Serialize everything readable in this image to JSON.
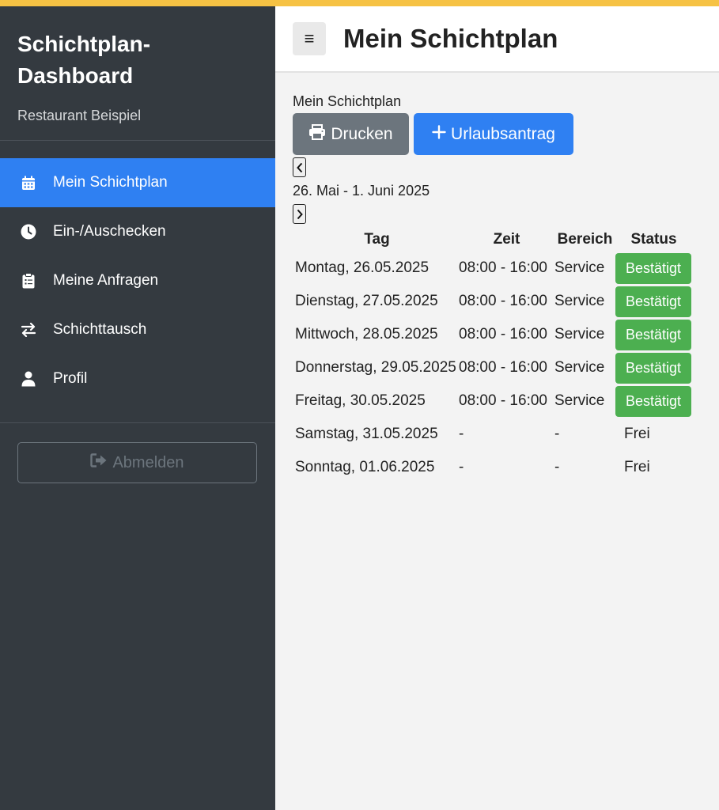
{
  "sidebar": {
    "title_line1": "Schichtplan-",
    "title_line2": "Dashboard",
    "subtitle": "Restaurant Beispiel",
    "items": [
      {
        "label": "Mein Schichtplan",
        "icon": "calendar-icon",
        "active": true
      },
      {
        "label": "Ein-/Auschecken",
        "icon": "clock-icon",
        "active": false
      },
      {
        "label": "Meine Anfragen",
        "icon": "clipboard-icon",
        "active": false
      },
      {
        "label": "Schichttausch",
        "icon": "swap-arrows-icon",
        "active": false
      },
      {
        "label": "Profil",
        "icon": "user-icon",
        "active": false
      }
    ],
    "logout_label": "Abmelden"
  },
  "header": {
    "menu_glyph": "≡",
    "title": "Mein Schichtplan"
  },
  "main": {
    "breadcrumb": "Mein Schichtplan",
    "print_label": "Drucken",
    "vacation_label": "Urlaubsantrag",
    "prev_glyph": "‹",
    "next_glyph": "›",
    "date_range": "26. Mai - 1. Juni 2025",
    "table": {
      "headers": [
        "Tag",
        "Zeit",
        "Bereich",
        "Status"
      ],
      "rows": [
        {
          "day": "Montag, 26.05.2025",
          "time": "08:00 - 16:00",
          "area": "Service",
          "status": "Bestätigt"
        },
        {
          "day": "Dienstag, 27.05.2025",
          "time": "08:00 - 16:00",
          "area": "Service",
          "status": "Bestätigt"
        },
        {
          "day": "Mittwoch, 28.05.2025",
          "time": "08:00 - 16:00",
          "area": "Service",
          "status": "Bestätigt"
        },
        {
          "day": "Donnerstag, 29.05.2025",
          "time": "08:00 - 16:00",
          "area": "Service",
          "status": "Bestätigt"
        },
        {
          "day": "Freitag, 30.05.2025",
          "time": "08:00 - 16:00",
          "area": "Service",
          "status": "Bestätigt"
        },
        {
          "day": "Samstag, 31.05.2025",
          "time": "-",
          "area": "-",
          "status": "Frei"
        },
        {
          "day": "Sonntag, 01.06.2025",
          "time": "-",
          "area": "-",
          "status": "Frei"
        }
      ]
    }
  },
  "colors": {
    "accent_bar": "#f6c244",
    "sidebar_bg": "#343a40",
    "active_item": "#2f80f2",
    "confirmed_badge": "#4caf50",
    "secondary_button": "#6c757d"
  }
}
